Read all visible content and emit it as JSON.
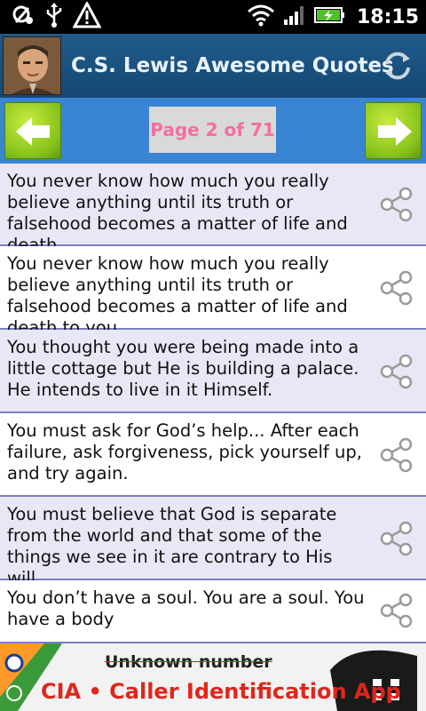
{
  "status_bar": {
    "time": "18:15",
    "icons": [
      "debug-icon",
      "usb-icon",
      "warning-icon",
      "wifi-icon",
      "signal-icon",
      "battery-charging-icon"
    ]
  },
  "header": {
    "title": "C.S. Lewis Awesome Quotes",
    "avatar": "author-portrait",
    "refresh_icon": "refresh-icon"
  },
  "pager": {
    "label": "Page 2 of 71",
    "prev_icon": "arrow-left-icon",
    "next_icon": "arrow-right-icon"
  },
  "quotes": [
    {
      "text": "You never know how much you really believe anything until its truth or falsehood becomes a matter of life and death."
    },
    {
      "text": "You never know how much you really believe anything until its truth or falsehood becomes a matter of life and death to you."
    },
    {
      "text": "You thought you were being made into a little cottage but He is building a palace. He intends to live in it Himself."
    },
    {
      "text": "You must ask for God’s help... After each failure, ask forgiveness, pick yourself up, and try again."
    },
    {
      "text": "You must believe that God is separate from the world and that some of the things we see in it are contrary to His will."
    },
    {
      "text": "You don’t have a soul. You are a soul. You have a body"
    }
  ],
  "ad": {
    "line1": "Unknown number",
    "line2": "CIA • Caller Identification App"
  },
  "colors": {
    "status_bar": "#000000",
    "app_bar": "#1b5283",
    "pager_bar": "#3a85d3",
    "nav_button": "#8cc61e",
    "page_label_text": "#f36ea0",
    "row_odd": "#e8e7f5",
    "row_divider": "#7b7ec2",
    "ad_accent": "#e0261c"
  }
}
